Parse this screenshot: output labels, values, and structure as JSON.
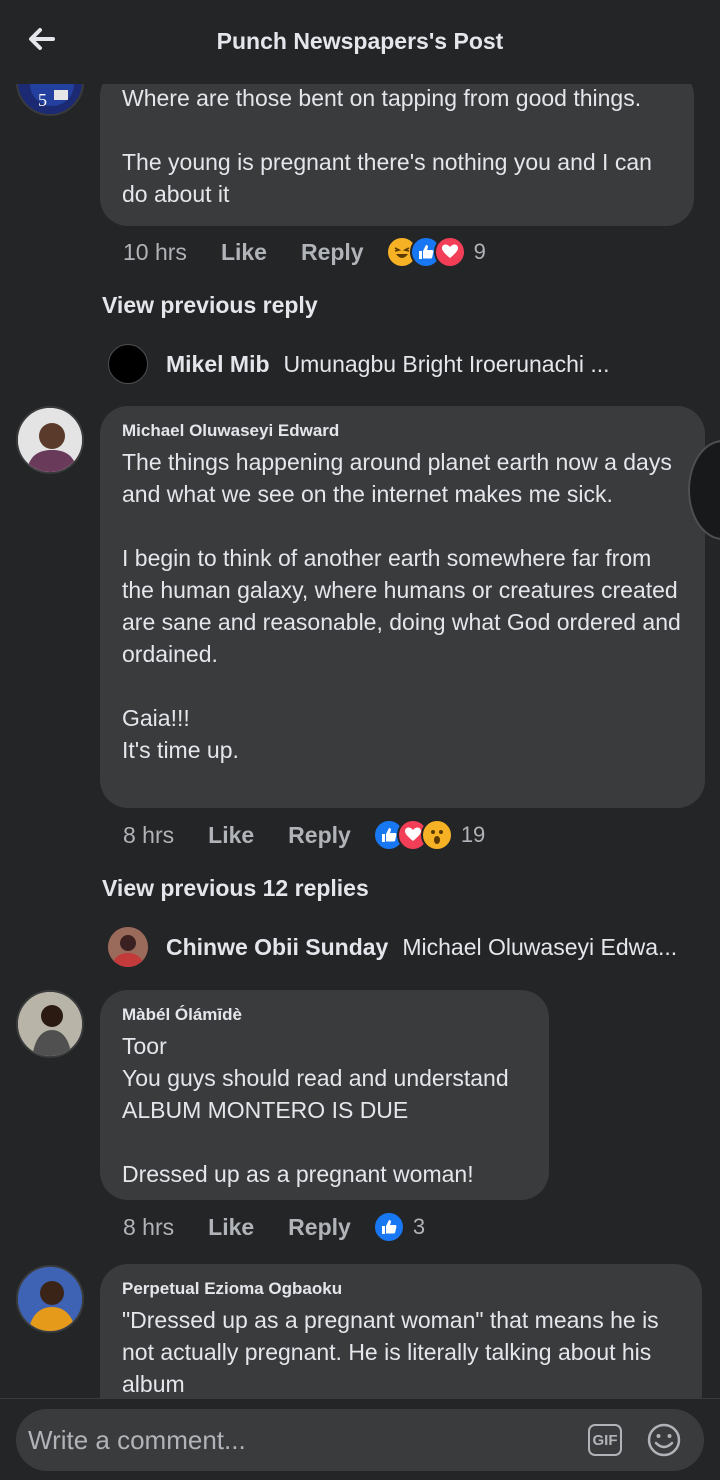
{
  "header": {
    "title": "Punch Newspapers's Post"
  },
  "comments": [
    {
      "body": "Where are those bent on tapping from good things.\n\nThe young is pregnant there's nothing you and I can do about it",
      "time": "10 hrs",
      "like": "Like",
      "reply": "Reply",
      "reaction_count": "9",
      "reactions": [
        "haha",
        "like",
        "love"
      ]
    },
    {
      "author": "Michael Oluwaseyi Edward",
      "body": "The things happening around planet earth now a days and what we see on the internet makes me sick.\n\nI begin to think of another earth somewhere far from the human galaxy, where humans or creatures created are sane and reasonable, doing what God ordered and ordained.\n\nGaia!!!\nIt's time up.",
      "time": "8 hrs",
      "like": "Like",
      "reply": "Reply",
      "reaction_count": "19",
      "reactions": [
        "like",
        "love",
        "wow"
      ]
    },
    {
      "author": "Màbél Ólámīdè",
      "body": "Toor\nYou guys should read and understand\nALBUM MONTERO IS DUE\n\nDressed up as a pregnant woman!",
      "time": "8 hrs",
      "like": "Like",
      "reply": "Reply",
      "reaction_count": "3",
      "reactions": [
        "like"
      ]
    },
    {
      "author": "Perpetual Ezioma Ogbaoku",
      "body": "\"Dressed up as a pregnant woman\" that means he is not actually pregnant. He is literally talking about his album"
    }
  ],
  "view_previous": [
    {
      "label": "View previous reply"
    },
    {
      "label": "View previous 12 replies"
    }
  ],
  "reply_previews": [
    {
      "name": "Mikel Mib",
      "text": "Umunagbu Bright Iroerunachi ..."
    },
    {
      "name": "Chinwe Obii Sunday",
      "text": "Michael Oluwaseyi Edwa..."
    }
  ],
  "composer": {
    "placeholder": "Write a comment...",
    "gif_label": "GIF"
  },
  "colors": {
    "background": "#242526",
    "bubble": "#3a3b3c",
    "like_blue": "#1877f2",
    "love_red": "#f33e58",
    "haha_yellow": "#f7b125"
  }
}
